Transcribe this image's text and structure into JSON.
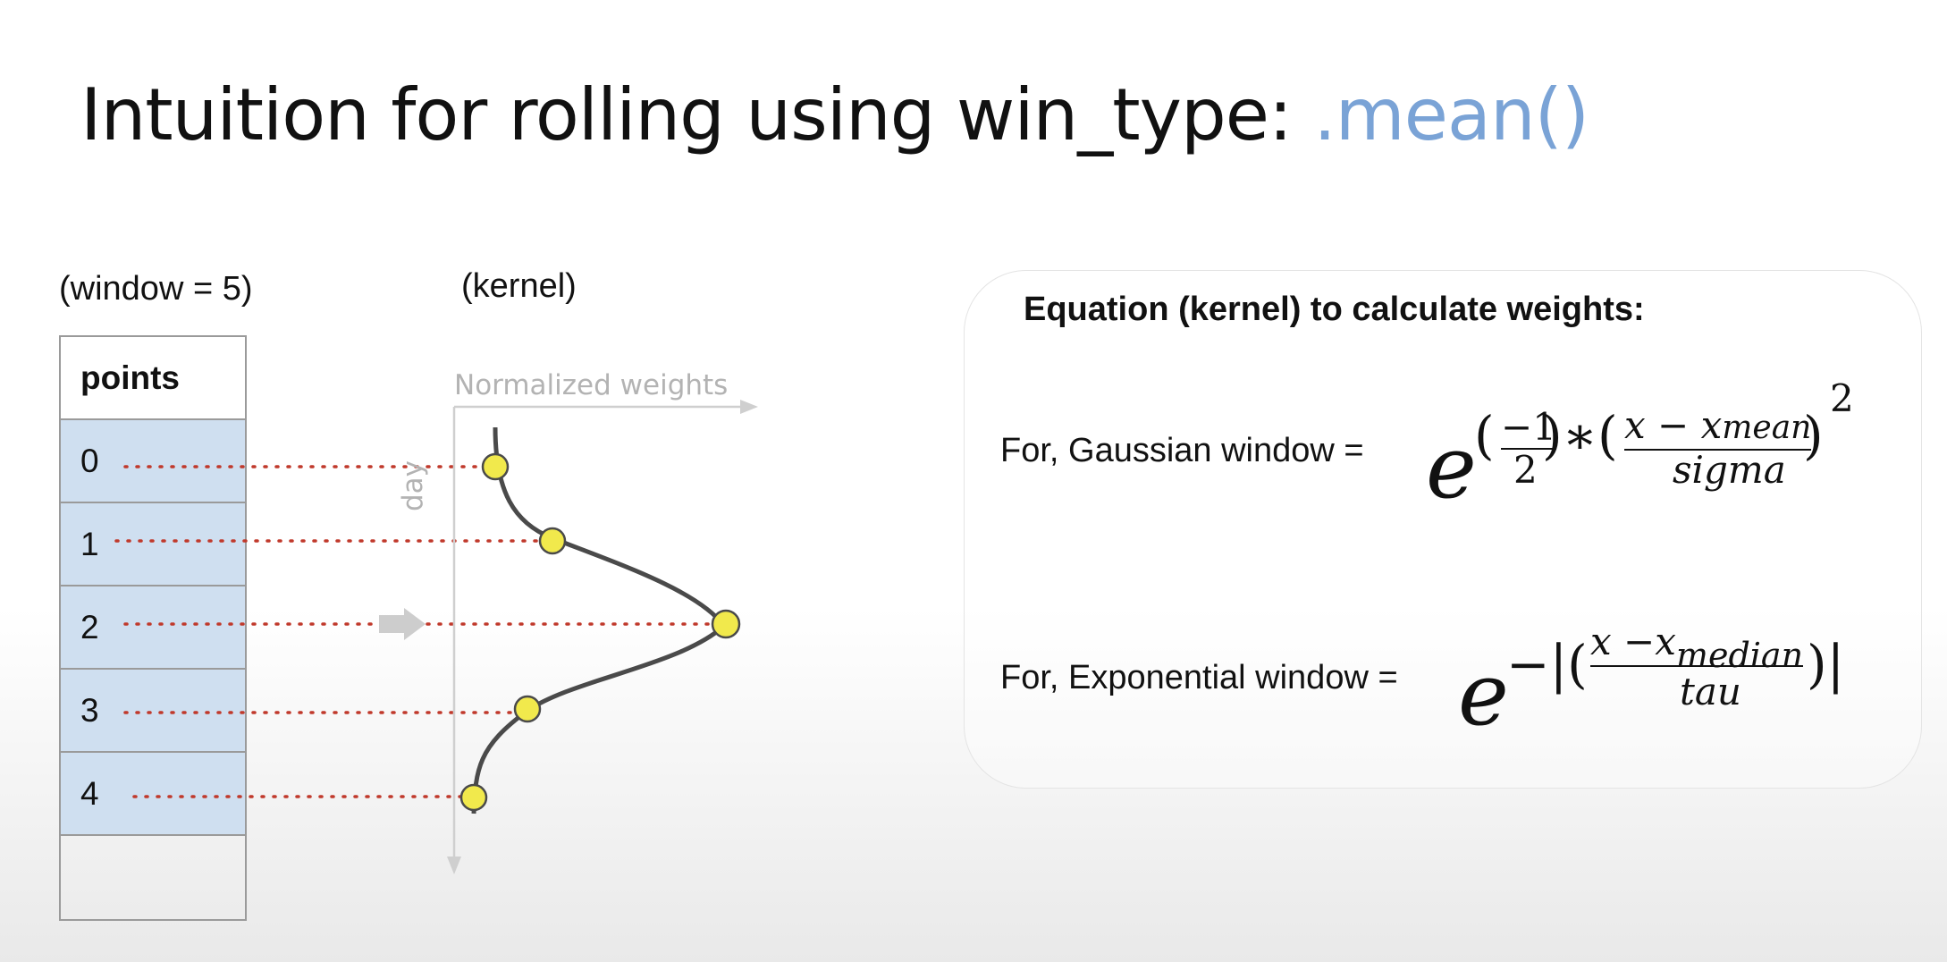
{
  "title": {
    "main": "Intuition for rolling using win_type: ",
    "accent": ".mean()",
    "accent_color": "#7aa3d6"
  },
  "captions": {
    "window": "(window = 5)",
    "kernel": "(kernel)"
  },
  "points_table": {
    "header": "points",
    "rows": [
      "0",
      "1",
      "2",
      "3",
      "4"
    ],
    "fill_color": "#cfdff0"
  },
  "kernel_plot": {
    "x_axis_label": "Normalized weights",
    "y_axis_label": "day",
    "point_color": "#f1e94c",
    "connector_color": "#c0392b",
    "marker": "right-arrow-icon"
  },
  "equations": {
    "heading": "Equation (kernel) to calculate weights:",
    "gaussian": {
      "label": "For, Gaussian window =",
      "base": "e",
      "exp_open": "(",
      "frac1_num": "−1",
      "frac1_den": "2",
      "exp_mid": ")∗(",
      "frac2_num": "x − x",
      "frac2_num_sub": "mean",
      "frac2_den": "sigma",
      "exp_close": ")",
      "power": "2"
    },
    "exponential": {
      "label": "For, Exponential window =",
      "base": "e",
      "exp_open": "−|(",
      "frac_num": "x −x",
      "frac_num_sub": "median",
      "frac_den": "tau",
      "exp_close": ")|"
    }
  }
}
